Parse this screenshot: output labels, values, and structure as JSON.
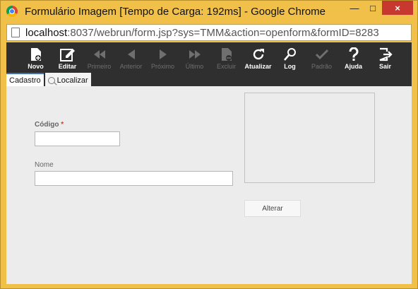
{
  "window": {
    "title": "Formulário Imagem [Tempo de Carga: 192ms] - Google Chrome",
    "controls": {
      "minimize": "—",
      "maximize": "□",
      "close": "×"
    }
  },
  "browser": {
    "url_host": "localhost",
    "url_rest": ":8037/webrun/form.jsp?sys=TMM&action=openform&formID=8283"
  },
  "toolbar": {
    "buttons": [
      {
        "label": "Novo",
        "icon": "new-document-icon",
        "enabled": true
      },
      {
        "label": "Editar",
        "icon": "edit-icon",
        "enabled": true
      },
      {
        "label": "Primeiro",
        "icon": "first-record-icon",
        "enabled": false
      },
      {
        "label": "Anterior",
        "icon": "previous-record-icon",
        "enabled": false
      },
      {
        "label": "Próximo",
        "icon": "next-record-icon",
        "enabled": false
      },
      {
        "label": "Último",
        "icon": "last-record-icon",
        "enabled": false
      },
      {
        "label": "Excluir",
        "icon": "delete-icon",
        "enabled": false
      },
      {
        "label": "Atualizar",
        "icon": "refresh-icon",
        "enabled": true
      },
      {
        "label": "Log",
        "icon": "log-icon",
        "enabled": true
      },
      {
        "label": "Padrão",
        "icon": "default-check-icon",
        "enabled": false
      },
      {
        "label": "Ajuda",
        "icon": "help-icon",
        "enabled": true
      },
      {
        "label": "Sair",
        "icon": "exit-icon",
        "enabled": true
      }
    ]
  },
  "tabs": [
    {
      "label": "Cadastro",
      "active": true
    },
    {
      "label": "Localizar",
      "active": false
    }
  ],
  "form": {
    "codigo": {
      "label": "Código",
      "required_marker": "*",
      "value": ""
    },
    "nome": {
      "label": "Nome",
      "value": ""
    },
    "alterar_button": "Alterar"
  },
  "colors": {
    "title_bar": "#f1c048",
    "toolbar": "#2f2f2f",
    "content_background": "#ececec",
    "required_marker": "#c8442b",
    "active_tab_accent": "#3f73b5"
  }
}
